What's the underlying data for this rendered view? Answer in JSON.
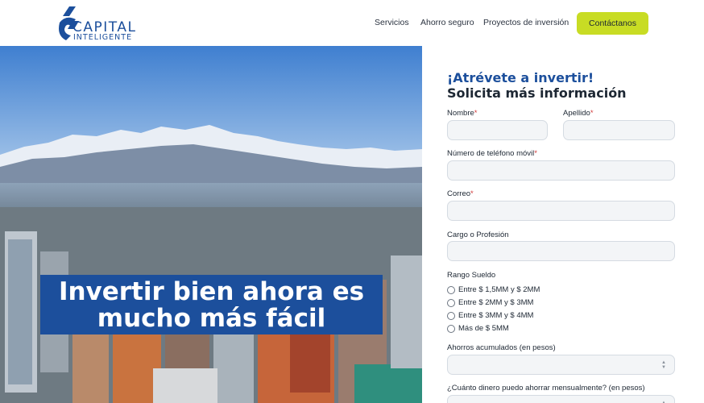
{
  "header": {
    "logo": {
      "line1": "CAPITAL",
      "line2": "INTELIGENTE"
    },
    "nav": [
      "Servicios",
      "Ahorro seguro",
      "Proyectos de inversión"
    ],
    "cta_label": "Contáctanos"
  },
  "hero": {
    "headline_line1": "Invertir bien ahora es",
    "headline_line2": "mucho más fácil"
  },
  "form": {
    "title1": "¡Atrévete a invertir!",
    "title2": "Solicita más información",
    "fields": {
      "nombre": "Nombre",
      "apellido": "Apellido",
      "telefono": "Número de teléfono móvil",
      "correo": "Correo",
      "cargo": "Cargo o Profesión",
      "ahorros": "Ahorros acumulados (en pesos)",
      "mensual": "¿Cuánto dinero puedo ahorrar mensualmente? (en pesos)"
    },
    "required_mark": "*",
    "rango": {
      "label": "Rango Sueldo",
      "options": [
        "Entre $ 1,5MM y $ 2MM",
        "Entre $ 2MM y $ 3MM",
        "Entre $ 3MM y $ 4MM",
        "Más de $ 5MM"
      ]
    }
  },
  "colors": {
    "brand_blue": "#1c4f9c",
    "cta_lime": "#c8dc24",
    "required_red": "#d23b3b"
  },
  "icons": [
    "logo-mark-icon",
    "spinner-icon"
  ]
}
